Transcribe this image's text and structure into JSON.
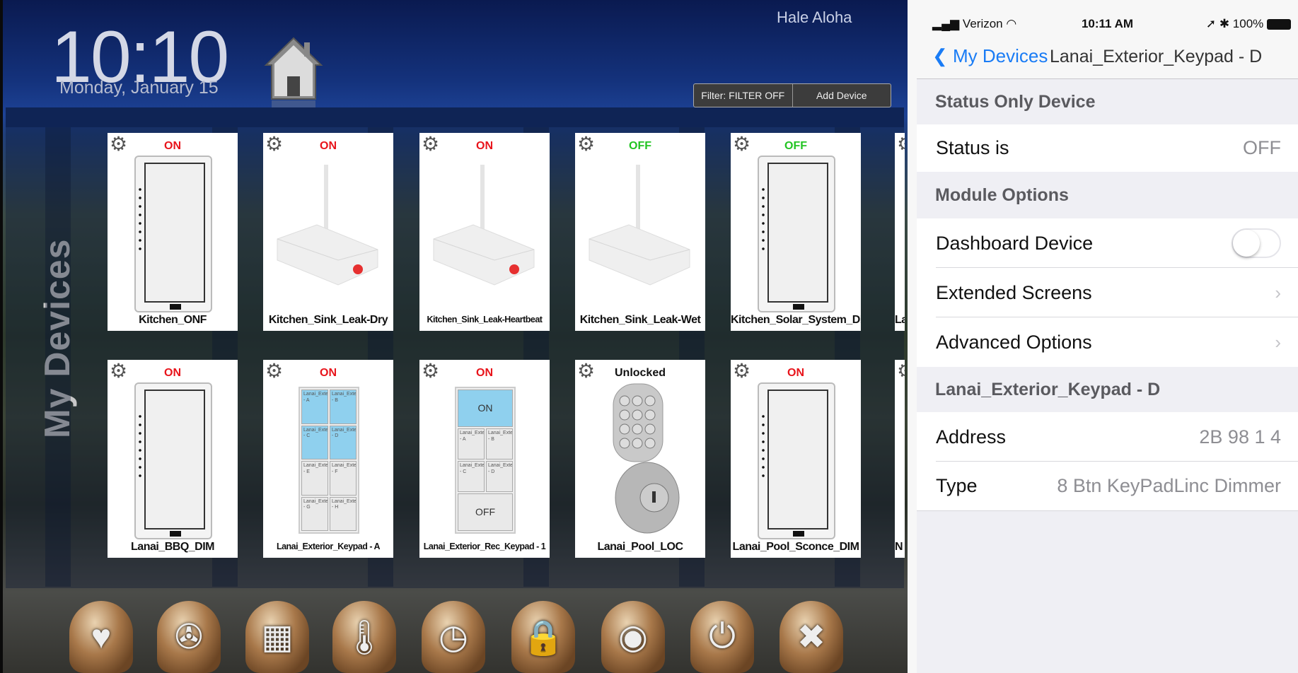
{
  "dashboard": {
    "time": "10:10",
    "date": "Monday, January 15",
    "site_name": "Hale Aloha",
    "filter_label": "Filter: FILTER OFF",
    "add_device_label": "Add Device",
    "section_title": "My Devices",
    "status_colors": {
      "on": "#e8141b",
      "off": "#22c422",
      "other": "#111111"
    },
    "tiles": [
      {
        "name": "Kitchen_ONF",
        "status": "ON",
        "kind": "dimmer"
      },
      {
        "name": "Kitchen_Sink_Leak-Dry",
        "status": "ON",
        "kind": "leak"
      },
      {
        "name": "Kitchen_Sink_Leak-Heartbeat",
        "status": "ON",
        "kind": "leak"
      },
      {
        "name": "Kitchen_Sink_Leak-Wet",
        "status": "OFF",
        "kind": "leak-off"
      },
      {
        "name": "Kitchen_Solar_System_DIM",
        "status": "OFF",
        "kind": "dimmer"
      },
      {
        "name": "Lanai_BBQ_DIM",
        "status": "ON",
        "kind": "dimmer"
      },
      {
        "name": "Lanai_Exterior_Keypad - A",
        "status": "ON",
        "kind": "keypad8"
      },
      {
        "name": "Lanai_Exterior_Rec_Keypad - 1",
        "status": "ON",
        "kind": "keypad6"
      },
      {
        "name": "Lanai_Pool_LOC",
        "status": "Unlocked",
        "kind": "lock"
      },
      {
        "name": "Lanai_Pool_Sconce_DIM",
        "status": "ON",
        "kind": "dimmer"
      }
    ],
    "partial_tiles": [
      "La",
      "N"
    ],
    "keypad8_buttons": [
      {
        "label": "Lanai_Exterior_Keypad - A",
        "lit": true
      },
      {
        "label": "Lanai_Exterior_Keypad - B",
        "lit": true
      },
      {
        "label": "Lanai_Exterior_Keypad - C",
        "lit": true
      },
      {
        "label": "Lanai_Exterior_Keypad - D",
        "lit": true
      },
      {
        "label": "Lanai_Exterior_Keypad - E",
        "lit": false
      },
      {
        "label": "Lanai_Exterior_Keypad - F",
        "lit": false
      },
      {
        "label": "Lanai_Exterior_Keypad - G",
        "lit": false
      },
      {
        "label": "Lanai_Exterior_Keypad - H",
        "lit": false
      }
    ],
    "keypad6_buttons": {
      "on": "ON",
      "off": "OFF",
      "small": [
        "Lanai_Exterior_Rec_Keypad - A",
        "Lanai_Exterior_Rec_Keypad - B",
        "Lanai_Exterior_Rec_Keypad - C",
        "Lanai_Exterior_Rec_Keypad - D"
      ]
    },
    "dock": [
      {
        "icon": "favorites-heart-icon",
        "glyph": "♥"
      },
      {
        "icon": "media-film-reel-icon",
        "glyph": "✇"
      },
      {
        "icon": "keypad-panel-icon",
        "glyph": "▦"
      },
      {
        "icon": "thermometer-icon",
        "glyph": "🌡"
      },
      {
        "icon": "timer-clock-icon",
        "glyph": "◷"
      },
      {
        "icon": "security-lock-icon",
        "glyph": "🔒"
      },
      {
        "icon": "camera-lens-icon",
        "glyph": "◉"
      },
      {
        "icon": "power-plug-icon",
        "glyph": "⏻"
      },
      {
        "icon": "tools-settings-icon",
        "glyph": "✖"
      }
    ]
  },
  "phone": {
    "carrier": "Verizon",
    "time": "10:11 AM",
    "battery": "100%",
    "back_label": "My Devices",
    "nav_title": "Lanai_Exterior_Keypad - D",
    "section1": "Status Only Device",
    "status_label": "Status is",
    "status_value": "OFF",
    "section2": "Module Options",
    "dashboard_device_label": "Dashboard Device",
    "dashboard_device_on": false,
    "extended_screens_label": "Extended Screens",
    "advanced_options_label": "Advanced Options",
    "section3": "Lanai_Exterior_Keypad - D",
    "address_label": "Address",
    "address_value": "2B 98 1 4",
    "type_label": "Type",
    "type_value": "8 Btn KeyPadLinc Dimmer",
    "accent": "#1a7cf5"
  }
}
